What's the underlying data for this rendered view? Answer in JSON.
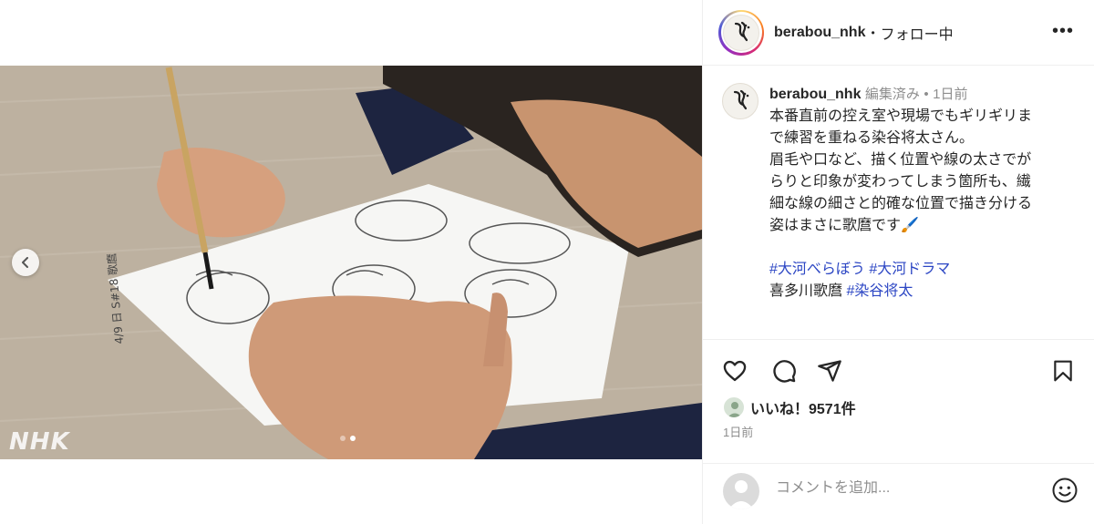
{
  "post": {
    "username": "berabou_nhk",
    "separator": "•",
    "follow_status": "フォロー中",
    "more_label": "•••",
    "watermark": "NHK",
    "slide_dots": [
      false,
      true
    ]
  },
  "caption": {
    "username": "berabou_nhk",
    "edited": "編集済み",
    "dot": "•",
    "time": "1日前",
    "lines": [
      "本番直前の控え室や現場でもギリギリま",
      "で練習を重ねる染谷将太さん。",
      "眉毛や口など、描く位置や線の太さでが",
      "らりと印象が変わってしまう箇所も、繊",
      "細な線の細さと的確な位置で描き分ける",
      "姿はまさに歌麿です🖌️"
    ],
    "hashtags_line1": [
      "#大河べらぼう",
      "#大河ドラマ"
    ],
    "line_last_prefix": "喜多川歌麿",
    "line_last_tag": "#染谷将太"
  },
  "actions": {
    "icons": [
      "heart-icon",
      "comment-icon",
      "share-icon",
      "bookmark-icon"
    ],
    "likes": "いいね！9571件",
    "time": "1日前"
  },
  "comment": {
    "placeholder": "コメントを追加..."
  },
  "colors": {
    "hashtag": "#2d47c4",
    "border": "#efefef",
    "muted": "#8e8e8e"
  }
}
